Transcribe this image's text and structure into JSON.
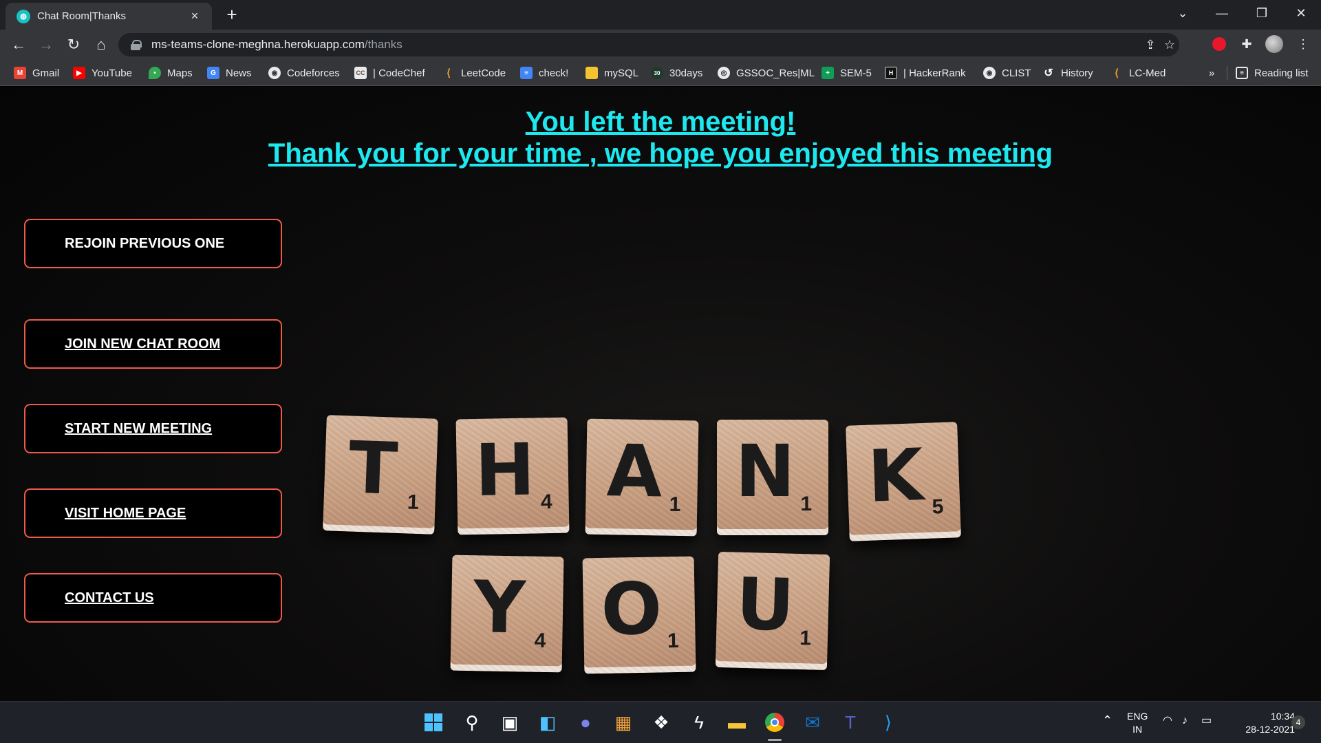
{
  "browser": {
    "tab": {
      "title": "Chat Room|Thanks",
      "favicon": "chat-icon"
    },
    "new_tab": "+",
    "window_controls": {
      "collapse": "⌄",
      "minimize": "—",
      "restore": "❐",
      "close": "✕"
    },
    "url": {
      "host": "ms-teams-clone-meghna.herokuapp.com",
      "path": "/thanks"
    },
    "bookmarks": [
      {
        "label": "Gmail",
        "icon": "gmail-icon",
        "color": "#ea4335",
        "glyph": "M"
      },
      {
        "label": "YouTube",
        "icon": "youtube-icon",
        "color": "#ff0000",
        "glyph": "▶"
      },
      {
        "label": "Maps",
        "icon": "maps-icon",
        "color": "#34a853",
        "glyph": "⬤"
      },
      {
        "label": "News",
        "icon": "news-icon",
        "color": "#4285f4",
        "glyph": "G"
      },
      {
        "label": "Codeforces",
        "icon": "globe-icon",
        "color": "#5f6368",
        "glyph": "◉"
      },
      {
        "label": "| CodeChef",
        "icon": "codechef-icon",
        "color": "#5c4638",
        "glyph": "CC"
      },
      {
        "label": "LeetCode",
        "icon": "leetcode-icon",
        "color": "#2b2b2b",
        "glyph": "L"
      },
      {
        "label": "check!",
        "icon": "docs-icon",
        "color": "#4285f4",
        "glyph": "≡"
      },
      {
        "label": "mySQL",
        "icon": "note-icon",
        "color": "#f4c430",
        "glyph": ""
      },
      {
        "label": "30days",
        "icon": "thirty-days-icon",
        "color": "#1e3a2a",
        "glyph": "30"
      },
      {
        "label": "GSSOC_Res|ML",
        "icon": "github-icon",
        "color": "#202124",
        "glyph": "◎"
      },
      {
        "label": "SEM-5",
        "icon": "sheets-icon",
        "color": "#0f9d58",
        "glyph": "+"
      },
      {
        "label": "| HackerRank",
        "icon": "hackerrank-icon",
        "color": "#111111",
        "glyph": "H"
      },
      {
        "label": "CLIST",
        "icon": "globe-icon",
        "color": "#5f6368",
        "glyph": "◉"
      },
      {
        "label": "History",
        "icon": "history-icon",
        "color": "#35363a",
        "glyph": "↺"
      },
      {
        "label": "LC-Med",
        "icon": "leetcode-icon",
        "color": "#2b2b2b",
        "glyph": "L"
      }
    ],
    "bookmarks_overflow": "»",
    "reading_list": "Reading list"
  },
  "page": {
    "headline_line1": "You left the meeting!",
    "headline_line2": "Thank you for your time , we hope you enjoyed this meeting",
    "buttons": {
      "rejoin": "REJOIN PREVIOUS ONE",
      "join_new": "JOIN NEW CHAT ROOM",
      "start_new": "START NEW MEETING",
      "visit_home": "VISIT HOME PAGE",
      "contact": "CONTACT US"
    },
    "tiles_row1": [
      {
        "letter": "T",
        "score": "1"
      },
      {
        "letter": "H",
        "score": "4"
      },
      {
        "letter": "A",
        "score": "1"
      },
      {
        "letter": "N",
        "score": "1"
      },
      {
        "letter": "K",
        "score": "5"
      }
    ],
    "tiles_row2": [
      {
        "letter": "Y",
        "score": "4"
      },
      {
        "letter": "O",
        "score": "1"
      },
      {
        "letter": "U",
        "score": "1"
      }
    ],
    "accent_color": "#1ee8ef",
    "button_border_color": "#f05a4e"
  },
  "taskbar": {
    "apps": [
      "start-icon",
      "search-icon",
      "task-view-icon",
      "widgets-icon",
      "chat-icon",
      "store-icon",
      "dropbox-icon",
      "bolt-icon",
      "file-explorer-icon",
      "chrome-icon",
      "mail-icon",
      "teams-icon",
      "vscode-icon"
    ],
    "language_top": "ENG",
    "language_bottom": "IN",
    "time": "10:34",
    "date": "28-12-2021",
    "notifications": "4"
  }
}
